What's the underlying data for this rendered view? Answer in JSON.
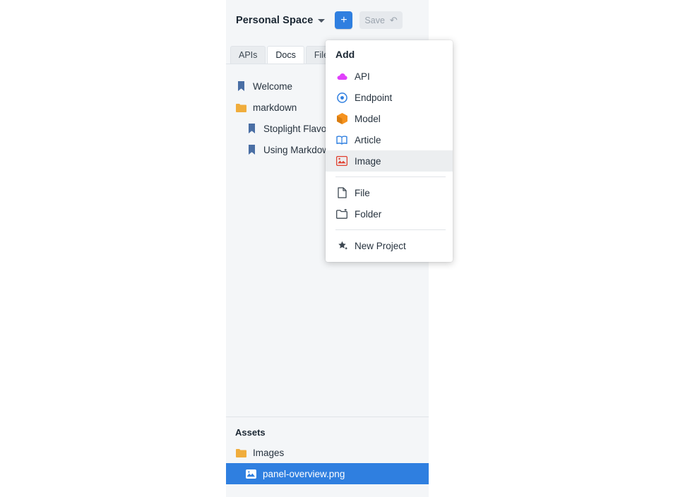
{
  "window": {
    "space_name": "Personal Space",
    "add_button_label": "+",
    "save_label": "Save",
    "undo_icon": "undo-icon"
  },
  "tabs": [
    {
      "label": "APIs",
      "active": false
    },
    {
      "label": "Docs",
      "active": true
    },
    {
      "label": "Files",
      "active": false
    }
  ],
  "tree": [
    {
      "label": "Welcome",
      "icon": "bookmark-icon",
      "indent": false
    },
    {
      "label": "markdown",
      "icon": "folder-icon",
      "indent": false
    },
    {
      "label": "Stoplight Flavored Markdown",
      "icon": "bookmark-icon",
      "indent": true
    },
    {
      "label": "Using Markdown",
      "icon": "bookmark-icon",
      "indent": true
    }
  ],
  "assets": {
    "title": "Assets",
    "items": [
      {
        "label": "Images",
        "icon": "folder-icon",
        "selected": false,
        "sub": false
      },
      {
        "label": "panel-overview.png",
        "icon": "image-icon",
        "selected": true,
        "sub": true
      }
    ]
  },
  "add_menu": {
    "title": "Add",
    "items": [
      {
        "label": "API",
        "icon": "api-cloud-icon",
        "hover": false,
        "sep_after": false
      },
      {
        "label": "Endpoint",
        "icon": "endpoint-target-icon",
        "hover": false,
        "sep_after": false
      },
      {
        "label": "Model",
        "icon": "model-cube-icon",
        "hover": false,
        "sep_after": false
      },
      {
        "label": "Article",
        "icon": "article-book-icon",
        "hover": false,
        "sep_after": false
      },
      {
        "label": "Image",
        "icon": "image-icon",
        "hover": true,
        "sep_after": true
      },
      {
        "label": "File",
        "icon": "file-icon",
        "hover": false,
        "sep_after": false
      },
      {
        "label": "Folder",
        "icon": "folder-icon",
        "hover": false,
        "sep_after": true
      },
      {
        "label": "New Project",
        "icon": "new-project-icon",
        "hover": false,
        "sep_after": false
      }
    ]
  },
  "colors": {
    "accent": "#2f7fe0",
    "panel_bg": "#f4f6f8",
    "api_icon": "#e040fb",
    "endpoint_icon": "#2f7fe0",
    "model_icon": "#f5921e",
    "article_icon": "#2f7fe0",
    "image_icon": "#e0402f",
    "bookmark_icon": "#4a6fa5",
    "folder_icon": "#f0ad3c"
  }
}
